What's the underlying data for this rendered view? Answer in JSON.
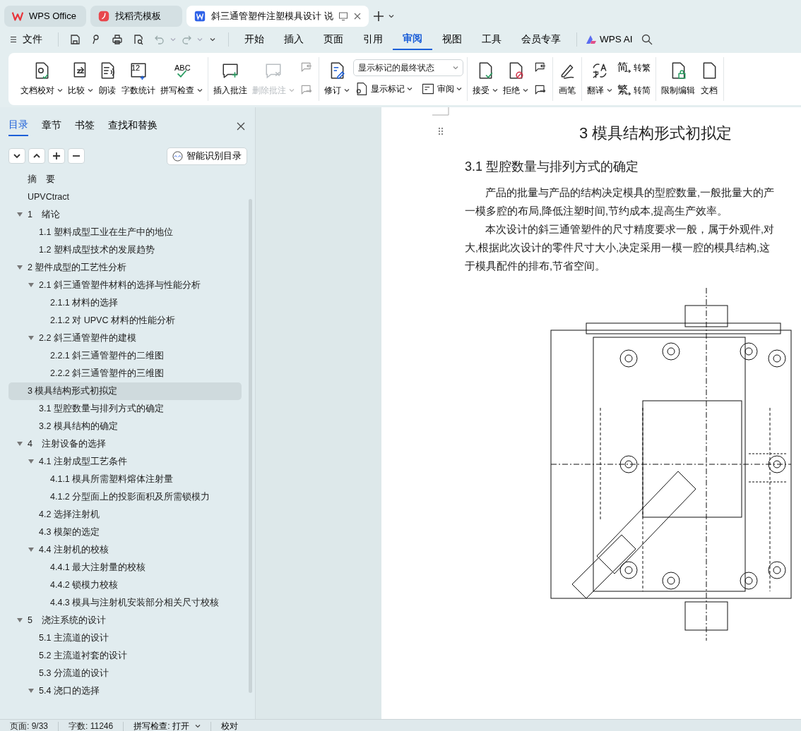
{
  "browser_tabs": [
    {
      "kind": "wps",
      "label": "WPS Office",
      "selected": false
    },
    {
      "kind": "docer",
      "label": "找稻壳模板",
      "selected": false
    },
    {
      "kind": "doc",
      "label": "斜三通管塑件注塑模具设计 说",
      "selected": true
    }
  ],
  "menu": {
    "file_label": "文件",
    "tabs": [
      {
        "label": "开始",
        "selected": false
      },
      {
        "label": "插入",
        "selected": false
      },
      {
        "label": "页面",
        "selected": false
      },
      {
        "label": "引用",
        "selected": false
      },
      {
        "label": "审阅",
        "selected": true
      },
      {
        "label": "视图",
        "selected": false
      },
      {
        "label": "工具",
        "selected": false
      },
      {
        "label": "会员专享",
        "selected": false
      }
    ],
    "ai_label": "WPS AI"
  },
  "ribbon": [
    {
      "items": [
        {
          "kind": "large",
          "label": "文档校对",
          "has_menu": true,
          "disabled": false
        },
        {
          "kind": "large",
          "label": "比较",
          "has_menu": true,
          "disabled": false
        },
        {
          "kind": "large",
          "label": "朗读",
          "has_menu": false,
          "disabled": false
        },
        {
          "kind": "large",
          "icon_text": "12",
          "label": "字数统计",
          "has_menu": false,
          "disabled": false
        },
        {
          "kind": "large",
          "icon_text": "ABC",
          "label": "拼写检查",
          "has_menu": true,
          "disabled": false
        }
      ]
    },
    {
      "items": [
        {
          "kind": "large",
          "label": "插入批注",
          "has_menu": false,
          "disabled": false
        },
        {
          "kind": "large",
          "label": "删除批注",
          "has_menu": true,
          "disabled": true
        },
        {
          "kind": "stack",
          "items": [
            {
              "has_menu": false,
              "disabled": true
            },
            {
              "has_menu": false,
              "disabled": true
            }
          ]
        }
      ]
    },
    {
      "items": [
        {
          "kind": "large",
          "label": "修订",
          "has_menu": true,
          "disabled": false
        },
        {
          "kind": "stack",
          "items": [
            {
              "kind": "select",
              "value": "显示标记的最终状态"
            },
            {
              "kind": "row",
              "items": [
                {
                  "label": "显示标记",
                  "has_menu": true,
                  "disabled": false
                },
                {
                  "label": "审阅",
                  "has_menu": true,
                  "disabled": false
                }
              ]
            }
          ]
        }
      ]
    },
    {
      "items": [
        {
          "kind": "large",
          "label": "接受",
          "has_menu": true,
          "disabled": false
        },
        {
          "kind": "large",
          "label": "拒绝",
          "has_menu": true,
          "disabled": false
        },
        {
          "kind": "stack",
          "items": [
            {
              "has_menu": false,
              "disabled": false
            },
            {
              "has_menu": false,
              "disabled": false
            }
          ]
        }
      ]
    },
    {
      "items": [
        {
          "kind": "large",
          "label": "画笔",
          "has_menu": false,
          "disabled": false
        }
      ]
    },
    {
      "items": [
        {
          "kind": "large",
          "label": "翻译",
          "has_menu": true,
          "disabled": false
        },
        {
          "kind": "stack",
          "items": [
            {
              "icon_text": "简",
              "label": "转繁",
              "has_menu": false,
              "disabled": false
            },
            {
              "icon_text": "繁",
              "label": "转简",
              "has_menu": false,
              "disabled": false
            }
          ]
        }
      ]
    },
    {
      "items": [
        {
          "kind": "large",
          "label": "限制编辑",
          "has_menu": false,
          "disabled": false
        },
        {
          "kind": "large",
          "label": "文档",
          "has_menu": false,
          "disabled": false
        }
      ]
    }
  ],
  "sidebar": {
    "tabs": [
      {
        "label": "目录",
        "selected": true
      },
      {
        "label": "章节",
        "selected": false
      },
      {
        "label": "书签",
        "selected": false
      },
      {
        "label": "查找和替换",
        "selected": false
      }
    ],
    "smart_button": "智能识别目录",
    "toc": [
      {
        "label": "摘　要",
        "selected": false
      },
      {
        "label": "UPVCtract",
        "selected": false
      },
      {
        "label": "1　绪论",
        "selected": false,
        "expanded": true,
        "children": [
          {
            "label": "1.1  塑料成型工业在生产中的地位",
            "selected": false
          },
          {
            "label": "1.2  塑料成型技术的发展趋势",
            "selected": false
          }
        ]
      },
      {
        "label": "2 塑件成型的工艺性分析",
        "selected": false,
        "expanded": true,
        "children": [
          {
            "label": "2.1 斜三通管塑件材料的选择与性能分析",
            "selected": false,
            "expanded": true,
            "children": [
              {
                "label": "2.1.1 材料的选择",
                "selected": false
              },
              {
                "label": "2.1.2  对 UPVC 材料的性能分析",
                "selected": false
              }
            ]
          },
          {
            "label": "2.2 斜三通管塑件的建模",
            "selected": false,
            "expanded": true,
            "children": [
              {
                "label": "2.2.1 斜三通管塑件的二维图",
                "selected": false
              },
              {
                "label": "2.2.2 斜三通管塑件的三维图",
                "selected": false
              }
            ]
          }
        ]
      },
      {
        "label": "3 模具结构形式初拟定",
        "selected": true,
        "children": [
          {
            "label": "3.1 型腔数量与排列方式的确定",
            "selected": false
          },
          {
            "label": "3.2 模具结构的确定",
            "selected": false
          }
        ]
      },
      {
        "label": "4　注射设备的选择",
        "selected": false,
        "expanded": true,
        "children": [
          {
            "label": "4.1  注射成型工艺条件",
            "selected": false,
            "expanded": true,
            "children": [
              {
                "label": "4.1.1  模具所需塑料熔体注射量",
                "selected": false
              },
              {
                "label": "4.1.2  分型面上的投影面积及所需锁模力",
                "selected": false
              }
            ]
          },
          {
            "label": "4.2  选择注射机",
            "selected": false
          },
          {
            "label": "4.3  模架的选定",
            "selected": false
          },
          {
            "label": "4.4  注射机的校核",
            "selected": false,
            "expanded": true,
            "children": [
              {
                "label": "4.4.1   最大注射量的校核",
                "selected": false
              },
              {
                "label": "4.4.2   锁模力校核",
                "selected": false
              },
              {
                "label": "4.4.3  模具与注射机安装部分相关尺寸校核",
                "selected": false
              }
            ]
          }
        ]
      },
      {
        "label": "5　浇注系统的设计",
        "selected": false,
        "expanded": true,
        "children": [
          {
            "label": "5.1  主流道的设计",
            "selected": false
          },
          {
            "label": "5.2  主流道衬套的设计",
            "selected": false
          },
          {
            "label": "5.3  分流道的设计",
            "selected": false
          },
          {
            "label": "5.4  浇口的选择",
            "selected": false,
            "expanded": true
          }
        ]
      }
    ]
  },
  "document": {
    "heading": "3 模具结构形式初拟定",
    "subheading": "3.1 型腔数量与排列方式的确定",
    "lines": [
      {
        "text": "产品的批量与产品的结构决定模具的型腔数量,一般批量大的产",
        "indent": true
      },
      {
        "text": "一模多腔的布局,降低注塑时间,节约成本,提高生产效率。",
        "indent": false
      },
      {
        "text": "本次设计的斜三通管塑件的尺寸精度要求一般，属于外观件,对",
        "indent": true
      },
      {
        "text": "大,根据此次设计的零件尺寸大小,决定采用一模一腔的模具结构,这",
        "indent": false
      },
      {
        "text": "于模具配件的排布,节省空间。",
        "indent": false
      }
    ]
  },
  "status_bar": {
    "page": "页面: 9/33",
    "words": "字数: 11246",
    "spell": "拼写检查: 打开",
    "proof": "校对"
  }
}
